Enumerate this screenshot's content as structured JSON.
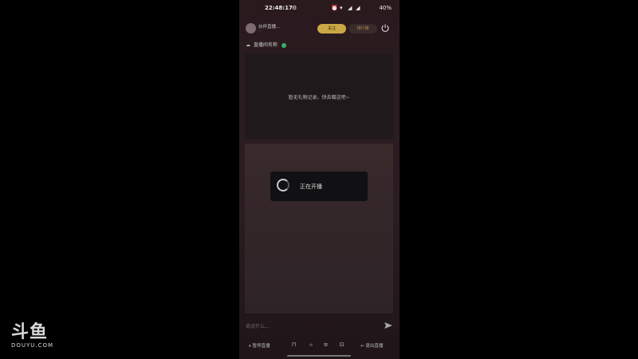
{
  "status_bar": {
    "time": "22:48:17",
    "battery": "40%"
  },
  "header": {
    "channel_name": "伙伴直播...",
    "channel_sub": "...",
    "follow_label": "关注",
    "rank_label": "排行榜"
  },
  "room": {
    "label": "直播间名称"
  },
  "top_panel": {
    "message": "暂无礼物记录，快去赠送吧~"
  },
  "toast": {
    "text": "正在开播"
  },
  "input": {
    "placeholder": "说点什么..."
  },
  "toolbar": {
    "pause_label": "暂停直播",
    "exit_label": "退出直播"
  },
  "watermark": {
    "logo": "斗鱼",
    "site": "DOUYU.COM"
  }
}
